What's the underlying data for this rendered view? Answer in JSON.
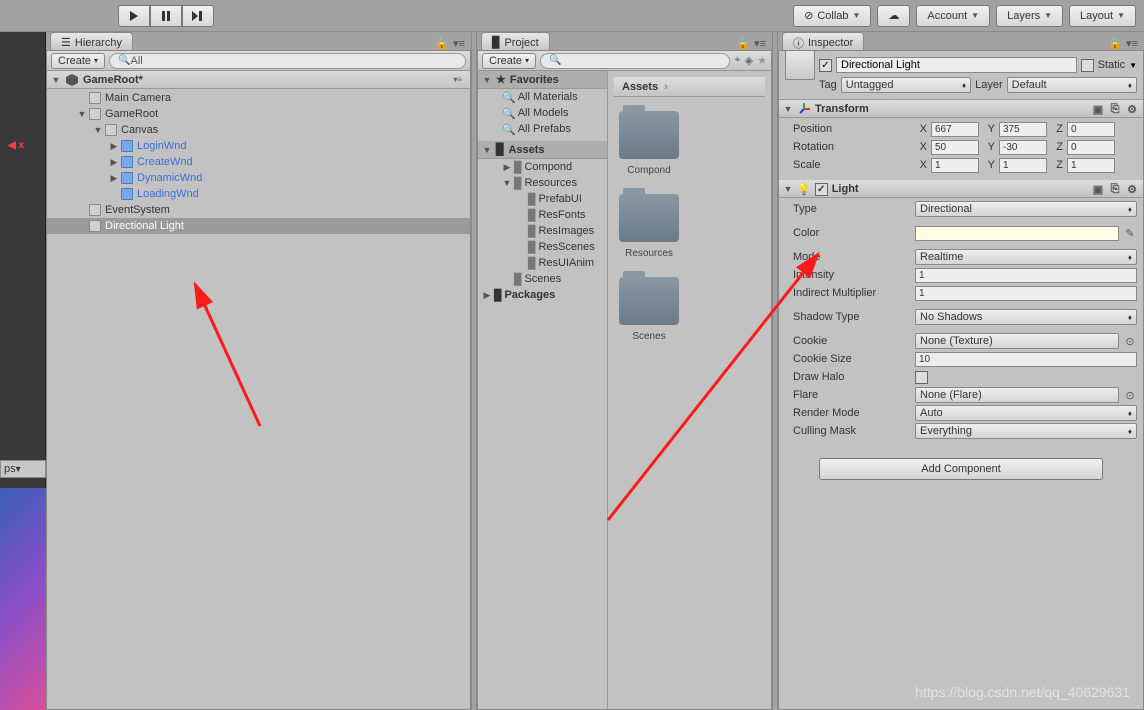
{
  "toolbar": {
    "collab": "Collab",
    "account": "Account",
    "layers": "Layers",
    "layout": "Layout"
  },
  "hierarchy": {
    "title": "Hierarchy",
    "create": "Create",
    "search": "All",
    "scene": "GameRoot*",
    "items": [
      {
        "label": "Main Camera",
        "indent": 1
      },
      {
        "label": "GameRoot",
        "indent": 1,
        "fold": "▼"
      },
      {
        "label": "Canvas",
        "indent": 2,
        "fold": "▼"
      },
      {
        "label": "LoginWnd",
        "indent": 3,
        "fold": "▶",
        "blue": true
      },
      {
        "label": "CreateWnd",
        "indent": 3,
        "fold": "▶",
        "blue": true
      },
      {
        "label": "DynamicWnd",
        "indent": 3,
        "fold": "▶",
        "blue": true
      },
      {
        "label": "LoadingWnd",
        "indent": 3,
        "blue": true
      },
      {
        "label": "EventSystem",
        "indent": 1
      },
      {
        "label": "Directional Light",
        "indent": 1,
        "sel": true
      }
    ]
  },
  "project": {
    "title": "Project",
    "create": "Create",
    "favorites": "Favorites",
    "fav_items": [
      "All Materials",
      "All Models",
      "All Prefabs"
    ],
    "assets": "Assets",
    "tree": [
      {
        "label": "Compond",
        "indent": 1,
        "fold": "▶"
      },
      {
        "label": "Resources",
        "indent": 1,
        "fold": "▼"
      },
      {
        "label": "PrefabUI",
        "indent": 2
      },
      {
        "label": "ResFonts",
        "indent": 2
      },
      {
        "label": "ResImages",
        "indent": 2
      },
      {
        "label": "ResScenes",
        "indent": 2
      },
      {
        "label": "ResUIAnim",
        "indent": 2
      },
      {
        "label": "Scenes",
        "indent": 1
      }
    ],
    "packages": "Packages",
    "crumb": "Assets",
    "folders": [
      "Compond",
      "Resources",
      "Scenes"
    ]
  },
  "inspector": {
    "title": "Inspector",
    "name": "Directional Light",
    "static": "Static",
    "tag_lbl": "Tag",
    "tag_val": "Untagged",
    "layer_lbl": "Layer",
    "layer_val": "Default",
    "transform": {
      "title": "Transform",
      "position": {
        "lbl": "Position",
        "x": "667",
        "y": "375",
        "z": "0"
      },
      "rotation": {
        "lbl": "Rotation",
        "x": "50",
        "y": "-30",
        "z": "0"
      },
      "scale": {
        "lbl": "Scale",
        "x": "1",
        "y": "1",
        "z": "1"
      }
    },
    "light": {
      "title": "Light",
      "type": {
        "lbl": "Type",
        "val": "Directional"
      },
      "color": {
        "lbl": "Color"
      },
      "mode": {
        "lbl": "Mode",
        "val": "Realtime"
      },
      "intensity": {
        "lbl": "Intensity",
        "val": "1"
      },
      "indirect": {
        "lbl": "Indirect Multiplier",
        "val": "1"
      },
      "shadow": {
        "lbl": "Shadow Type",
        "val": "No Shadows"
      },
      "cookie": {
        "lbl": "Cookie",
        "val": "None (Texture)"
      },
      "cookiesize": {
        "lbl": "Cookie Size",
        "val": "10"
      },
      "drawhalo": {
        "lbl": "Draw Halo"
      },
      "flare": {
        "lbl": "Flare",
        "val": "None (Flare)"
      },
      "rendermode": {
        "lbl": "Render Mode",
        "val": "Auto"
      },
      "cullmask": {
        "lbl": "Culling Mask",
        "val": "Everything"
      }
    },
    "addcomp": "Add Component"
  },
  "watermark": "https://blog.csdn.net/qq_40629631",
  "axis_labels": {
    "x": "X",
    "y": "Y",
    "z": "Z"
  },
  "misc": {
    "ps": "ps",
    "giz_x": "◀ x",
    "search_icon": "🔍"
  }
}
